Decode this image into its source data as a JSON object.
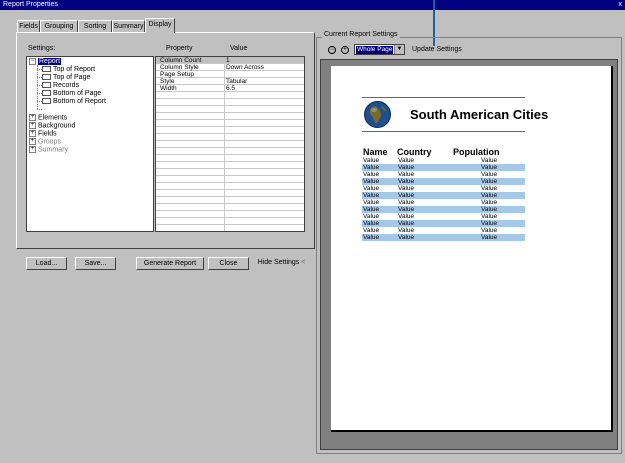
{
  "window": {
    "title": "Report Properties"
  },
  "tabs": [
    {
      "label": "Fields"
    },
    {
      "label": "Grouping"
    },
    {
      "label": "Sorting"
    },
    {
      "label": "Summary"
    },
    {
      "label": "Display"
    }
  ],
  "settings_label": "Settings:",
  "property_header": "Property",
  "value_header": "Value",
  "tree": {
    "report": "Report",
    "top_of_report": "Top of Report",
    "top_of_page": "Top of Page",
    "records": "Records",
    "bottom_of_page": "Bottom of Page",
    "bottom_of_report": "Bottom of Report",
    "elements": "Elements",
    "background": "Background",
    "fields": "Fields",
    "groups": "Groups",
    "summary": "Summary"
  },
  "properties": [
    {
      "property": "Column Count",
      "value": "1"
    },
    {
      "property": "Column Style",
      "value": "Down Across"
    },
    {
      "property": "Page Setup",
      "value": ""
    },
    {
      "property": "Style",
      "value": "Tabular"
    },
    {
      "property": "Width",
      "value": "6.5"
    }
  ],
  "buttons": {
    "load": "Load...",
    "save": "Save...",
    "generate": "Generate Report",
    "close": "Close",
    "hide_settings": "Hide Settings"
  },
  "current_settings_label": "Current Report Settings",
  "zoom": {
    "value": "Whole Page"
  },
  "update_settings": "Update Settings",
  "preview": {
    "title": "South American Cities",
    "columns": [
      "Name",
      "Country",
      "Population"
    ],
    "rows": [
      [
        "Value",
        "Value",
        "Value"
      ],
      [
        "Value",
        "Value",
        "Value"
      ],
      [
        "Value",
        "Value",
        "Value"
      ],
      [
        "Value",
        "Value",
        "Value"
      ],
      [
        "Value",
        "Value",
        "Value"
      ],
      [
        "Value",
        "Value",
        "Value"
      ],
      [
        "Value",
        "Value",
        "Value"
      ],
      [
        "Value",
        "Value",
        "Value"
      ],
      [
        "Value",
        "Value",
        "Value"
      ],
      [
        "Value",
        "Value",
        "Value"
      ],
      [
        "Value",
        "Value",
        "Value"
      ],
      [
        "Value",
        "Value",
        "Value"
      ]
    ],
    "highlight_color": "#a6c8e8",
    "rule_color": "#3a6ea5"
  },
  "colors": {
    "titlebar": "#000080",
    "face": "#c0c0c0",
    "callout": "#1f5fa8"
  }
}
